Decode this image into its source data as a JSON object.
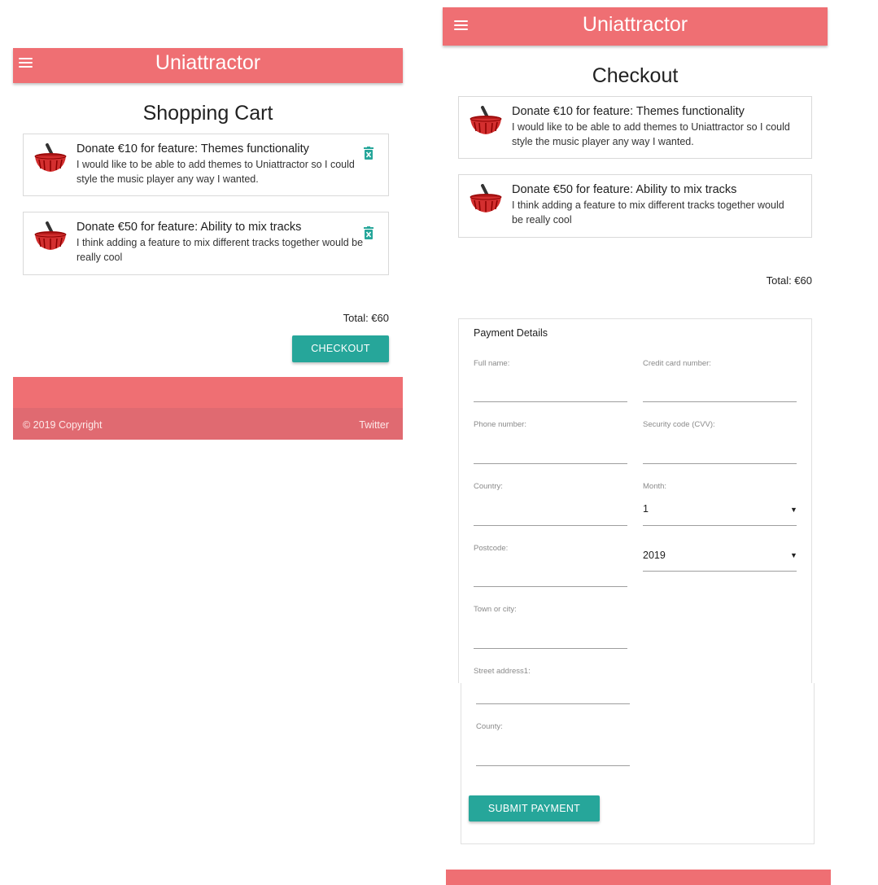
{
  "brand": "Uniattractor",
  "cart": {
    "title": "Shopping Cart",
    "total": "Total: €60",
    "checkout_label": "CHECKOUT",
    "footer": {
      "copyright": "© 2019 Copyright",
      "twitter": "Twitter"
    }
  },
  "items": [
    {
      "title": "Donate €10 for feature: Themes functionality",
      "desc_line1": "I would like to be able to add themes to Uniattractor so I could",
      "desc_line2": "style the music player any way I wanted."
    },
    {
      "title": "Donate €50 for feature: Ability to mix tracks",
      "desc_line1": "I think adding a feature to mix different tracks together would be",
      "desc_line2": "really cool"
    }
  ],
  "checkout": {
    "title": "Checkout",
    "items": [
      {
        "title": "Donate €10 for feature: Themes functionality",
        "desc_line1": "I would like to be able to add themes to Uniattractor so I could",
        "desc_line2": "style the music player any way I wanted."
      },
      {
        "title": "Donate €50 for feature: Ability to mix tracks",
        "desc_line1": "I think adding a feature to mix different tracks together would",
        "desc_line2": "be really cool"
      }
    ],
    "total": "Total: €60",
    "payment": {
      "title": "Payment Details",
      "full_name": "Full name:",
      "card_number": "Credit card number:",
      "phone": "Phone number:",
      "cvv": "Security code (CVV):",
      "country": "Country:",
      "month": "Month:",
      "month_value": "1",
      "postcode": "Postcode:",
      "year_value": "2019",
      "town": "Town or city:",
      "street": "Street address1:",
      "county": "County:",
      "submit_label": "SUBMIT PAYMENT"
    }
  },
  "colors": {
    "navbar": "#ef6f73",
    "footer_bottom": "#e06a71",
    "button": "#26a69a",
    "trash": "#26a69a"
  },
  "icons": {
    "menu": "menu-icon",
    "basket": "basket-icon",
    "trash": "trash-icon",
    "dropdown": "dropdown-arrow-icon"
  }
}
